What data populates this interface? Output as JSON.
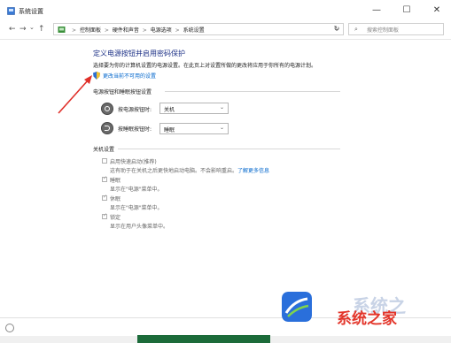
{
  "window": {
    "title": "系统设置",
    "min_label": "—",
    "max_label": "☐",
    "close_label": "✕"
  },
  "nav": {
    "back": "←",
    "forward": "→",
    "up_dropdown": "⌄",
    "up": "↑",
    "breadcrumbs": [
      "控制面板",
      "硬件和声音",
      "电源选项",
      "系统设置"
    ],
    "separator": ">",
    "addr_dropdown": "⌄",
    "refresh": "↻",
    "search_placeholder": "搜索控制面板"
  },
  "header": {
    "title": "定义电源按钮并启用密码保护",
    "description": "选择要为你的计算机设置的电源设置。在此页上对设置所做的更改将应用于你所有的电源计划。",
    "change_link": "更改当前不可用的设置"
  },
  "power_buttons": {
    "section_title": "电源按钮和睡眠按钮设置",
    "rows": [
      {
        "label": "按电源按钮时:",
        "value": "关机"
      },
      {
        "label": "按睡眠按钮时:",
        "value": "睡眠"
      }
    ]
  },
  "shutdown": {
    "section_title": "关机设置",
    "items": [
      {
        "label": "启用快速启动(推荐)",
        "checked": false,
        "sub": "这有助于在关机之后更快地启动电脑。不会影响重启。",
        "link": "了解更多信息"
      },
      {
        "label": "睡眠",
        "checked": true,
        "sub": "显示在\"电源\"菜单中。"
      },
      {
        "label": "休眠",
        "checked": true,
        "sub": "显示在\"电源\"菜单中。"
      },
      {
        "label": "锁定",
        "checked": true,
        "sub": "显示在用户头像菜单中。"
      }
    ]
  },
  "watermark": {
    "text": "系统之家",
    "ghost": "系统之"
  },
  "colors": {
    "accent_title": "#1e3287",
    "link": "#0066cc",
    "annotation_arrow": "#e0302a"
  }
}
